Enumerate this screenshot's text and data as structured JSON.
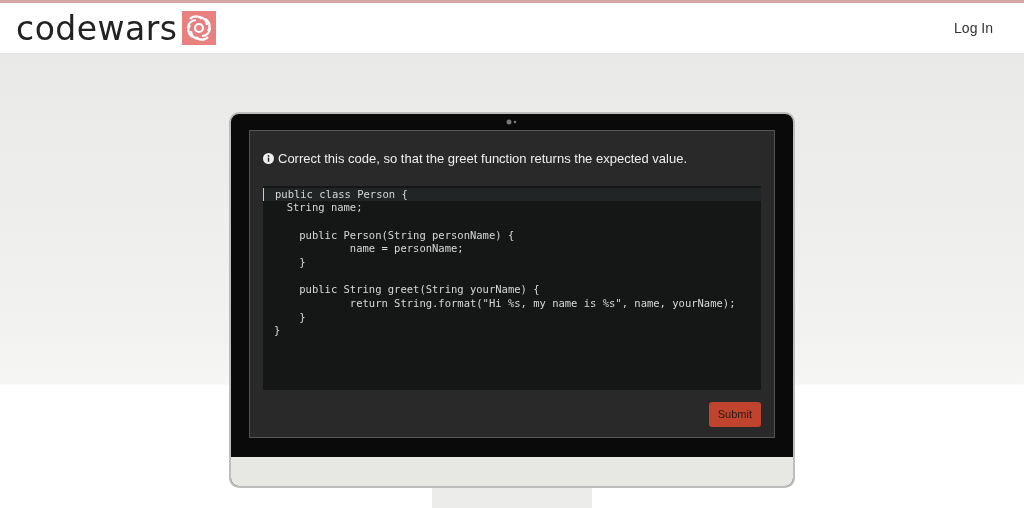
{
  "header": {
    "logo": "codewars",
    "login": "Log In"
  },
  "challenge": {
    "prompt": "Correct this code, so that the greet function returns the expected value.",
    "code_blocks": [
      [
        {
          "text": "public class Person {",
          "active": true
        },
        {
          "text": "  String name;",
          "active": false
        }
      ],
      [
        {
          "text": "    public Person(String personName) {",
          "active": false
        },
        {
          "text": "            name = personName;",
          "active": false
        },
        {
          "text": "    }",
          "active": false
        }
      ],
      [
        {
          "text": "    public String greet(String yourName) {",
          "active": false
        },
        {
          "text": "            return String.format(\"Hi %s, my name is %s\", name, yourName);",
          "active": false
        },
        {
          "text": "    }",
          "active": false
        },
        {
          "text": "}",
          "active": false
        }
      ]
    ],
    "submit": "Submit"
  }
}
